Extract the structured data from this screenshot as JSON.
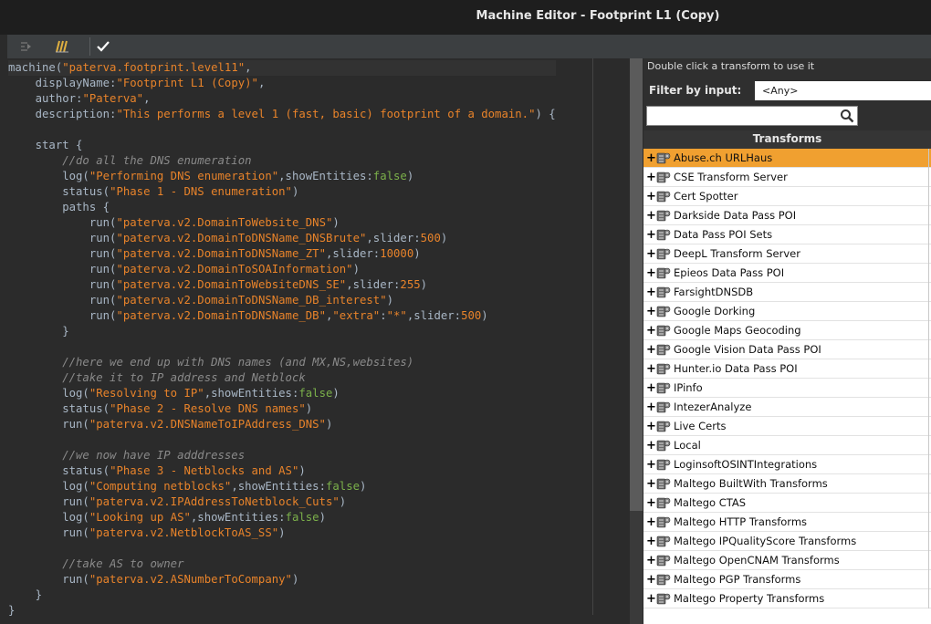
{
  "window": {
    "title": "Machine Editor - Footprint L1 (Copy)"
  },
  "toolbar": {
    "buttons": [
      "indent-icon",
      "comment-icon",
      "checkmark-icon"
    ]
  },
  "code_lines": [
    [
      [
        "p",
        "machine("
      ],
      [
        "s",
        "\"paterva.footprint.level11\""
      ],
      [
        "p",
        ","
      ]
    ],
    [
      [
        "p",
        "    displayName:"
      ],
      [
        "s",
        "\"Footprint L1 (Copy)\""
      ],
      [
        "p",
        ","
      ]
    ],
    [
      [
        "p",
        "    author:"
      ],
      [
        "s",
        "\"Paterva\""
      ],
      [
        "p",
        ","
      ]
    ],
    [
      [
        "p",
        "    description:"
      ],
      [
        "s",
        "\"This performs a level 1 (fast, basic) footprint of a domain.\""
      ],
      [
        "p",
        ") {"
      ]
    ],
    [
      [
        "p",
        ""
      ]
    ],
    [
      [
        "p",
        "    start {"
      ]
    ],
    [
      [
        "c",
        "        //do all the DNS enumeration"
      ]
    ],
    [
      [
        "p",
        "        log("
      ],
      [
        "s",
        "\"Performing DNS enumeration\""
      ],
      [
        "p",
        ",showEntities:"
      ],
      [
        "k",
        "false"
      ],
      [
        "p",
        ")"
      ]
    ],
    [
      [
        "p",
        "        status("
      ],
      [
        "s",
        "\"Phase 1 - DNS enumeration\""
      ],
      [
        "p",
        ")"
      ]
    ],
    [
      [
        "p",
        "        paths {"
      ]
    ],
    [
      [
        "p",
        "            run("
      ],
      [
        "s",
        "\"paterva.v2.DomainToWebsite_DNS\""
      ],
      [
        "p",
        ")"
      ]
    ],
    [
      [
        "p",
        "            run("
      ],
      [
        "s",
        "\"paterva.v2.DomainToDNSName_DNSBrute\""
      ],
      [
        "p",
        ",slider:"
      ],
      [
        "n",
        "500"
      ],
      [
        "p",
        ")"
      ]
    ],
    [
      [
        "p",
        "            run("
      ],
      [
        "s",
        "\"paterva.v2.DomainToDNSName_ZT\""
      ],
      [
        "p",
        ",slider:"
      ],
      [
        "n",
        "10000"
      ],
      [
        "p",
        ")"
      ]
    ],
    [
      [
        "p",
        "            run("
      ],
      [
        "s",
        "\"paterva.v2.DomainToSOAInformation\""
      ],
      [
        "p",
        ")"
      ]
    ],
    [
      [
        "p",
        "            run("
      ],
      [
        "s",
        "\"paterva.v2.DomainToWebsiteDNS_SE\""
      ],
      [
        "p",
        ",slider:"
      ],
      [
        "n",
        "255"
      ],
      [
        "p",
        ")"
      ]
    ],
    [
      [
        "p",
        "            run("
      ],
      [
        "s",
        "\"paterva.v2.DomainToDNSName_DB_interest\""
      ],
      [
        "p",
        ")"
      ]
    ],
    [
      [
        "p",
        "            run("
      ],
      [
        "s",
        "\"paterva.v2.DomainToDNSName_DB\""
      ],
      [
        "p",
        ","
      ],
      [
        "s",
        "\"extra\""
      ],
      [
        "p",
        ":"
      ],
      [
        "s",
        "\"*\""
      ],
      [
        "p",
        ",slider:"
      ],
      [
        "n",
        "500"
      ],
      [
        "p",
        ")"
      ]
    ],
    [
      [
        "p",
        "        }"
      ]
    ],
    [
      [
        "p",
        ""
      ]
    ],
    [
      [
        "c",
        "        //here we end up with DNS names (and MX,NS,websites)"
      ]
    ],
    [
      [
        "c",
        "        //take it to IP address and Netblock"
      ]
    ],
    [
      [
        "p",
        "        log("
      ],
      [
        "s",
        "\"Resolving to IP\""
      ],
      [
        "p",
        ",showEntities:"
      ],
      [
        "k",
        "false"
      ],
      [
        "p",
        ")"
      ]
    ],
    [
      [
        "p",
        "        status("
      ],
      [
        "s",
        "\"Phase 2 - Resolve DNS names\""
      ],
      [
        "p",
        ")"
      ]
    ],
    [
      [
        "p",
        "        run("
      ],
      [
        "s",
        "\"paterva.v2.DNSNameToIPAddress_DNS\""
      ],
      [
        "p",
        ")"
      ]
    ],
    [
      [
        "p",
        ""
      ]
    ],
    [
      [
        "c",
        "        //we now have IP adddresses"
      ]
    ],
    [
      [
        "p",
        "        status("
      ],
      [
        "s",
        "\"Phase 3 - Netblocks and AS\""
      ],
      [
        "p",
        ")"
      ]
    ],
    [
      [
        "p",
        "        log("
      ],
      [
        "s",
        "\"Computing netblocks\""
      ],
      [
        "p",
        ",showEntities:"
      ],
      [
        "k",
        "false"
      ],
      [
        "p",
        ")"
      ]
    ],
    [
      [
        "p",
        "        run("
      ],
      [
        "s",
        "\"paterva.v2.IPAddressToNetblock_Cuts\""
      ],
      [
        "p",
        ")"
      ]
    ],
    [
      [
        "p",
        "        log("
      ],
      [
        "s",
        "\"Looking up AS\""
      ],
      [
        "p",
        ",showEntities:"
      ],
      [
        "k",
        "false"
      ],
      [
        "p",
        ")"
      ]
    ],
    [
      [
        "p",
        "        run("
      ],
      [
        "s",
        "\"paterva.v2.NetblockToAS_SS\""
      ],
      [
        "p",
        ")"
      ]
    ],
    [
      [
        "p",
        ""
      ]
    ],
    [
      [
        "c",
        "        //take AS to owner"
      ]
    ],
    [
      [
        "p",
        "        run("
      ],
      [
        "s",
        "\"paterva.v2.ASNumberToCompany\""
      ],
      [
        "p",
        ")"
      ]
    ],
    [
      [
        "p",
        "    }"
      ]
    ],
    [
      [
        "p",
        "}"
      ]
    ]
  ],
  "panel": {
    "hint": "Double click a transform to use it",
    "filter_label": "Filter by input:",
    "filter_value": "<Any>",
    "search_placeholder": "",
    "list_header": "Transforms",
    "selected_index": 0,
    "selected_color": "#f0a030",
    "items": [
      "Abuse.ch URLHaus",
      "CSE Transform Server",
      "Cert Spotter",
      "Darkside Data Pass POI",
      "Data Pass POI Sets",
      "DeepL Transform Server",
      "Epieos Data Pass POI",
      "FarsightDNSDB",
      "Google Dorking",
      "Google Maps Geocoding",
      "Google Vision Data Pass POI",
      "Hunter.io Data Pass POI",
      "IPinfo",
      "IntezerAnalyze",
      "Live Certs",
      "Local",
      "LoginsoftOSINTIntegrations",
      "Maltego BuiltWith Transforms",
      "Maltego CTAS",
      "Maltego HTTP Transforms",
      "Maltego IPQualityScore Transforms",
      "Maltego OpenCNAM Transforms",
      "Maltego PGP Transforms",
      "Maltego Property Transforms"
    ]
  },
  "colors": {
    "string": "#e8832a",
    "keyword": "#7bb04a",
    "comment": "#8a8a8a",
    "editor_bg": "#2b2b2b"
  }
}
